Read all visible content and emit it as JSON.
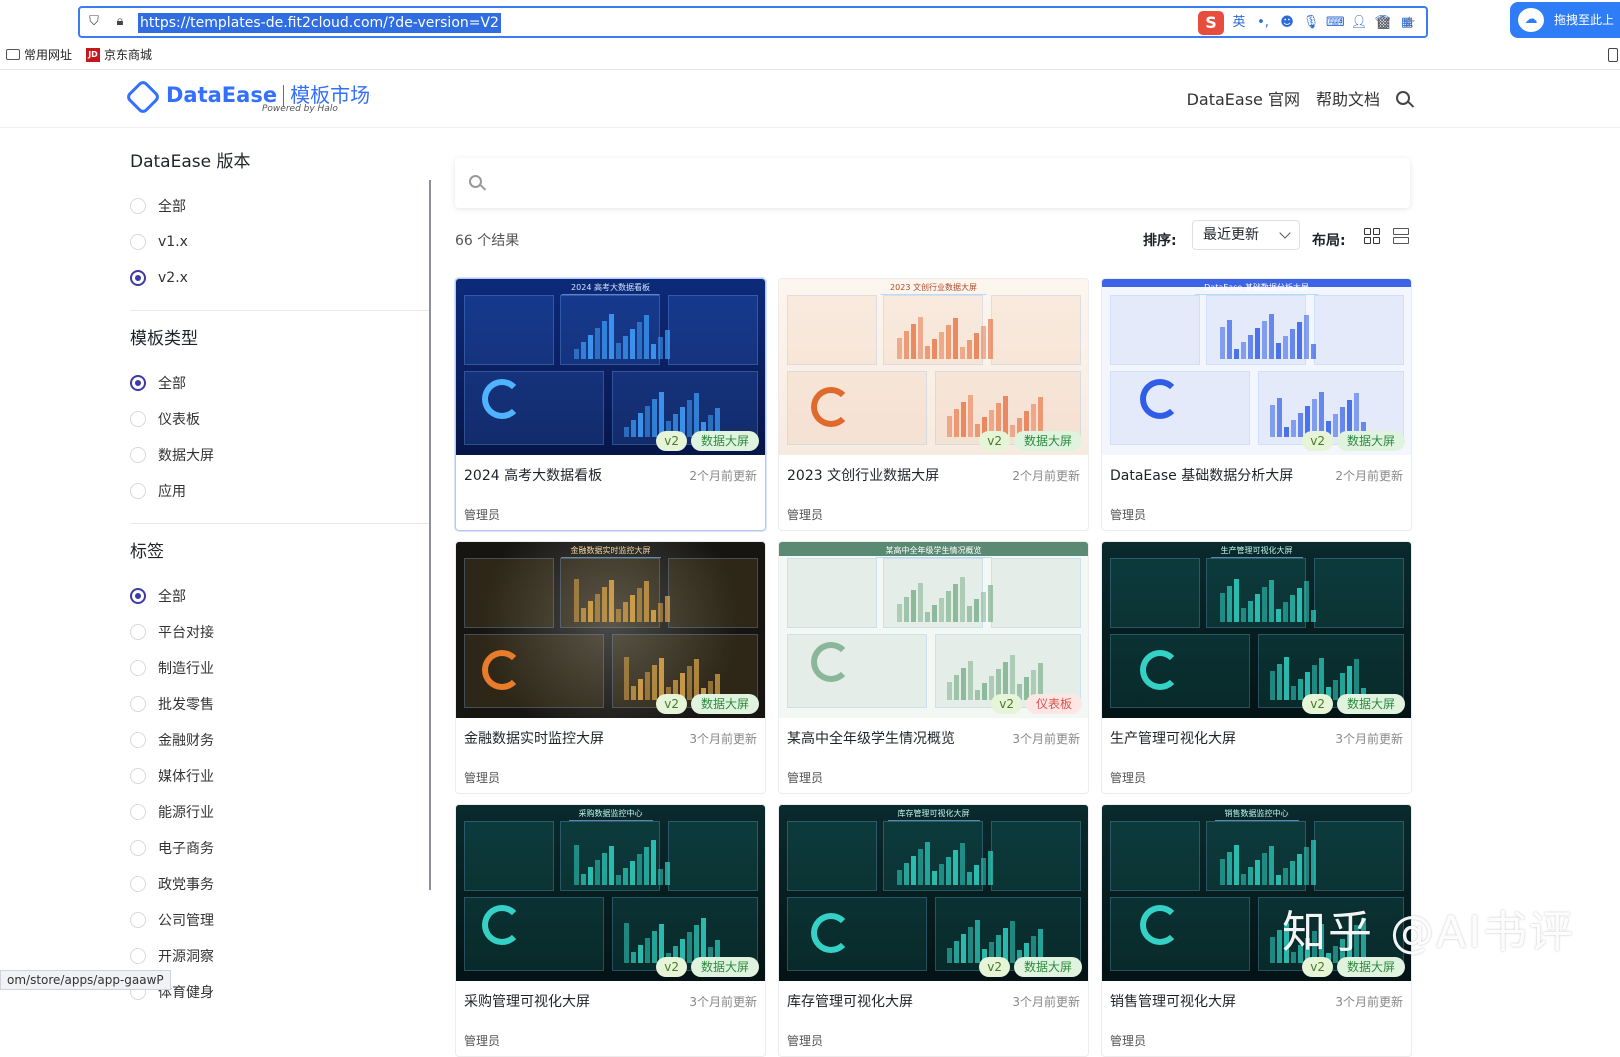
{
  "browser": {
    "url": "https://templates-de.fit2cloud.com/?de-version=V2",
    "ime_label": "英",
    "baidu_label": "拖拽至此上传",
    "bookmarks": [
      {
        "label": "常用网址",
        "icon": "folder-icon"
      },
      {
        "label": "京东商城",
        "icon": "jd-icon"
      }
    ],
    "status_url": "om/store/apps/app-gaawP"
  },
  "site": {
    "logo_name": "DataEase",
    "logo_sub": "模板市场",
    "powered": "Powered by Halo",
    "nav": [
      "DataEase 官网",
      "帮助文档"
    ]
  },
  "sidebar": {
    "version": {
      "title": "DataEase 版本",
      "options": [
        "全部",
        "v1.x",
        "v2.x"
      ],
      "selected": 2
    },
    "type": {
      "title": "模板类型",
      "options": [
        "全部",
        "仪表板",
        "数据大屏",
        "应用"
      ],
      "selected": 0
    },
    "tags": {
      "title": "标签",
      "options": [
        "全部",
        "平台对接",
        "制造行业",
        "批发零售",
        "金融财务",
        "媒体行业",
        "能源行业",
        "电子商务",
        "政党事务",
        "公司管理",
        "开源洞察",
        "体育健身"
      ],
      "selected": 0
    }
  },
  "main": {
    "search_placeholder": "",
    "result_count": "66 个结果",
    "sort_label": "排序:",
    "sort_value": "最近更新",
    "layout_label": "布局:",
    "cards": [
      {
        "name": "2024 高考大数据看板",
        "time": "2个月前更新",
        "author": "管理员",
        "version": "v2",
        "type": "数据大屏",
        "theme": "blue",
        "thumb_title": "2024 高考大数据看板"
      },
      {
        "name": "2023 文创行业数据大屏",
        "time": "2个月前更新",
        "author": "管理员",
        "version": "v2",
        "type": "数据大屏",
        "theme": "cream",
        "thumb_title": "2023 文创行业数据大屏"
      },
      {
        "name": "DataEase 基础数据分析大屏",
        "time": "2个月前更新",
        "author": "管理员",
        "version": "v2",
        "type": "数据大屏",
        "theme": "white",
        "thumb_title": "DataEase 基础数据分析大屏"
      },
      {
        "name": "金融数据实时监控大屏",
        "time": "3个月前更新",
        "author": "管理员",
        "version": "v2",
        "type": "数据大屏",
        "theme": "gold",
        "thumb_title": "金融数据实时监控大屏"
      },
      {
        "name": "某高中全年级学生情况概览",
        "time": "3个月前更新",
        "author": "管理员",
        "version": "v2",
        "type": "仪表板",
        "theme": "green",
        "thumb_title": "某高中全年级学生情况概览"
      },
      {
        "name": "生产管理可视化大屏",
        "time": "3个月前更新",
        "author": "管理员",
        "version": "v2",
        "type": "数据大屏",
        "theme": "teal",
        "thumb_title": "生产管理可视化大屏"
      },
      {
        "name": "采购管理可视化大屏",
        "time": "3个月前更新",
        "author": "管理员",
        "version": "v2",
        "type": "数据大屏",
        "theme": "teal",
        "thumb_title": "采购数据监控中心"
      },
      {
        "name": "库存管理可视化大屏",
        "time": "3个月前更新",
        "author": "管理员",
        "version": "v2",
        "type": "数据大屏",
        "theme": "teal",
        "thumb_title": "库存管理可视化大屏"
      },
      {
        "name": "销售管理可视化大屏",
        "time": "3个月前更新",
        "author": "管理员",
        "version": "v2",
        "type": "数据大屏",
        "theme": "teal",
        "thumb_title": "销售数据监控中心"
      }
    ]
  },
  "watermark": "知乎 @AI书评",
  "colors": {
    "accent": "#3370ff",
    "radio": "#3d3aa8",
    "blue": "#0b1f5e",
    "cream": "#fbf3ea",
    "white": "#f4f7fc",
    "gold": "#1c1a17",
    "green": "#f3f8f4",
    "teal": "#06191c"
  }
}
